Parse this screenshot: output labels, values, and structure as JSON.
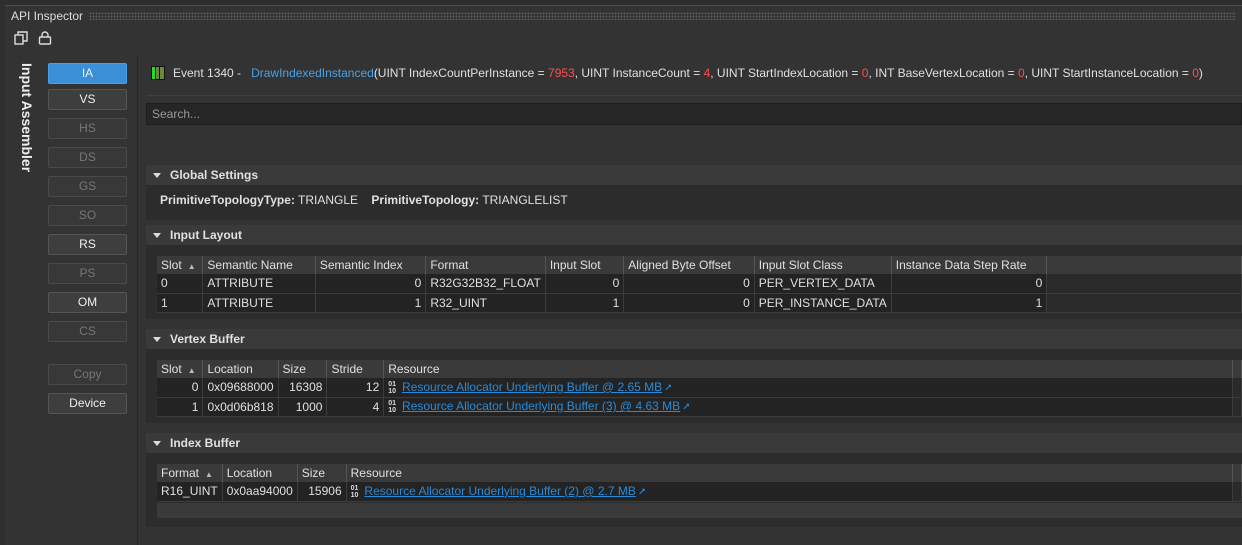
{
  "window": {
    "title": "API Inspector"
  },
  "sidebar": {
    "stage_label": "Input Assembler",
    "buttons": [
      {
        "label": "IA",
        "state": "active"
      },
      {
        "label": "VS",
        "state": "enabled"
      },
      {
        "label": "HS",
        "state": "disabled"
      },
      {
        "label": "DS",
        "state": "disabled"
      },
      {
        "label": "GS",
        "state": "disabled"
      },
      {
        "label": "SO",
        "state": "disabled"
      },
      {
        "label": "RS",
        "state": "enabled"
      },
      {
        "label": "PS",
        "state": "disabled"
      },
      {
        "label": "OM",
        "state": "enabled"
      },
      {
        "label": "CS",
        "state": "disabled"
      },
      {
        "label": "Copy",
        "state": "disabled"
      },
      {
        "label": "Device",
        "state": "enabled"
      }
    ]
  },
  "event": {
    "prefix": "Event 1340 -",
    "function": "DrawIndexedInstanced",
    "p1": "(UINT IndexCountPerInstance = ",
    "v1": "7953",
    "p2": ", UINT InstanceCount = ",
    "v2": "4",
    "p3": ", UINT StartIndexLocation = ",
    "v3": "0",
    "p4": ", INT BaseVertexLocation = ",
    "v4": "0",
    "p5": ", UINT StartInstanceLocation = ",
    "v5": "0",
    "p6": ")"
  },
  "search": {
    "placeholder": "Search..."
  },
  "global": {
    "title": "Global Settings",
    "k1": "PrimitiveTopologyType:",
    "v1": "TRIANGLE",
    "k2": "PrimitiveTopology:",
    "v2": "TRIANGLELIST"
  },
  "input_layout": {
    "title": "Input Layout",
    "columns": [
      "Slot",
      "Semantic Name",
      "Semantic Index",
      "Format",
      "Input Slot",
      "Aligned Byte Offset",
      "Input Slot Class",
      "Instance Data Step Rate"
    ],
    "rows": [
      [
        "0",
        "ATTRIBUTE",
        "0",
        "R32G32B32_FLOAT",
        "0",
        "0",
        "PER_VERTEX_DATA",
        "0"
      ],
      [
        "1",
        "ATTRIBUTE",
        "1",
        "R32_UINT",
        "1",
        "0",
        "PER_INSTANCE_DATA",
        "1"
      ]
    ]
  },
  "vertex_buffer": {
    "title": "Vertex Buffer",
    "columns": [
      "Slot",
      "Location",
      "Size",
      "Stride",
      "Resource"
    ],
    "rows": [
      [
        "0",
        "0x09688000",
        "16308",
        "12",
        "Resource Allocator Underlying Buffer @ 2.65 MB"
      ],
      [
        "1",
        "0x0d06b818",
        "1000",
        "4",
        "Resource Allocator Underlying Buffer (3) @ 4.63 MB"
      ]
    ]
  },
  "index_buffer": {
    "title": "Index Buffer",
    "columns": [
      "Format",
      "Location",
      "Size",
      "Resource"
    ],
    "rows": [
      [
        "R16_UINT",
        "0x0aa94000",
        "15906",
        "Resource Allocator Underlying Buffer (2) @ 2.7 MB"
      ]
    ]
  }
}
